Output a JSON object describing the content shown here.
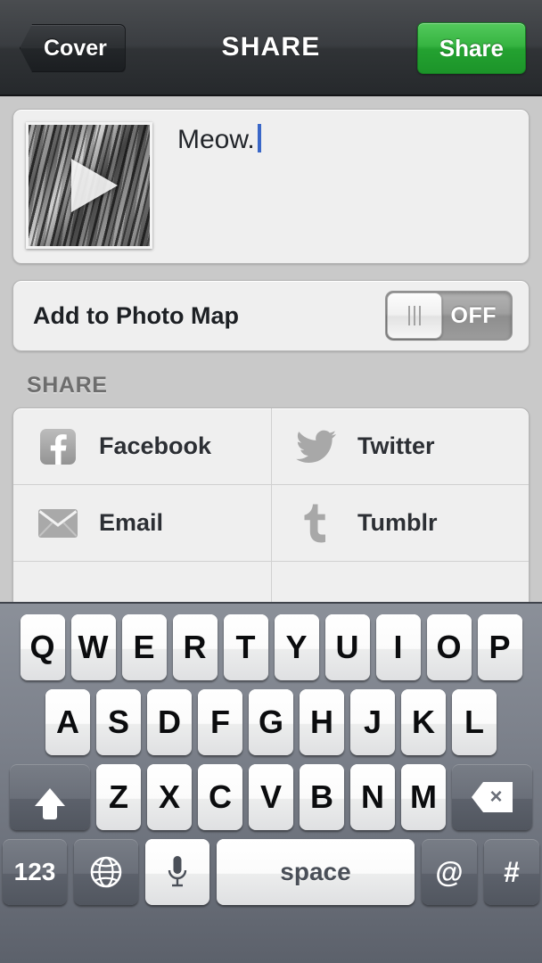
{
  "navbar": {
    "back_label": "Cover",
    "title": "SHARE",
    "share_label": "Share",
    "share_button_color": "#2aa633",
    "bar_color": "#33363a"
  },
  "caption": {
    "text": "Meow.",
    "caret_color": "#3a67c8",
    "thumbnail_type": "video",
    "play_icon": "play-triangle"
  },
  "photo_map": {
    "label": "Add to Photo Map",
    "switch_state": "OFF",
    "switch_label": "OFF"
  },
  "share_section": {
    "header": "SHARE",
    "services": [
      [
        {
          "label": "Facebook",
          "icon": "facebook-icon"
        },
        {
          "label": "Twitter",
          "icon": "twitter-bird-icon"
        }
      ],
      [
        {
          "label": "Email",
          "icon": "envelope-icon"
        },
        {
          "label": "Tumblr",
          "icon": "tumblr-icon"
        }
      ]
    ]
  },
  "keyboard": {
    "row1": [
      "Q",
      "W",
      "E",
      "R",
      "T",
      "Y",
      "U",
      "I",
      "O",
      "P"
    ],
    "row2": [
      "A",
      "S",
      "D",
      "F",
      "G",
      "H",
      "J",
      "K",
      "L"
    ],
    "row3": [
      "Z",
      "X",
      "C",
      "V",
      "B",
      "N",
      "M"
    ],
    "shift_icon": "shift-arrow-icon",
    "delete_icon": "backspace-icon",
    "numeric_label": "123",
    "globe_icon": "globe-icon",
    "mic_icon": "microphone-icon",
    "space_label": "space",
    "at_label": "@",
    "hash_label": "#",
    "background_color": "#757a84"
  }
}
